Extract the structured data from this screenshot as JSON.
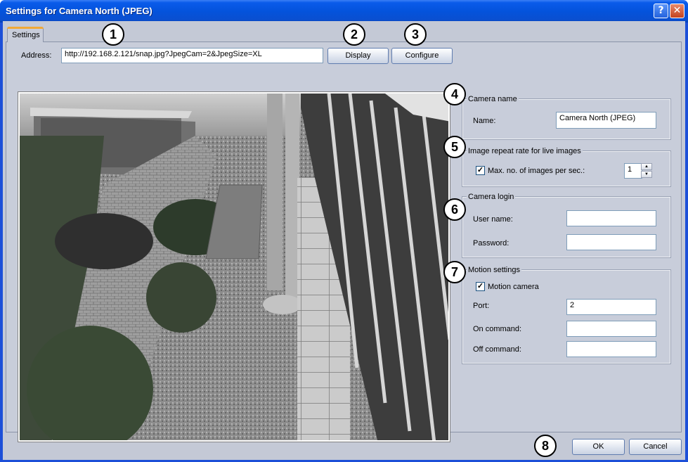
{
  "window": {
    "title": "Settings for Camera North (JPEG)",
    "help_glyph": "?",
    "close_glyph": "✕"
  },
  "tabs": [
    {
      "label": "Settings",
      "active": true
    }
  ],
  "address": {
    "label": "Address:",
    "value": "http://192.168.2.121/snap.jpg?JpegCam=2&JpegSize=XL"
  },
  "toolbar": {
    "display_label": "Display",
    "configure_label": "Configure"
  },
  "camera_name": {
    "group_title": "Camera name",
    "name_label": "Name:",
    "name_value": "Camera North (JPEG)"
  },
  "repeat_rate": {
    "group_title": "Image repeat rate for live images",
    "checkbox_label": "Max. no. of images per sec.:",
    "checked": true,
    "value": "1"
  },
  "login": {
    "group_title": "Camera login",
    "user_label": "User name:",
    "user_value": "",
    "password_label": "Password:",
    "password_value": ""
  },
  "motion": {
    "group_title": "Motion settings",
    "checkbox_label": "Motion camera",
    "checked": true,
    "port_label": "Port:",
    "port_value": "2",
    "on_label": "On command:",
    "on_value": "",
    "off_label": "Off command:",
    "off_value": ""
  },
  "footer": {
    "ok_label": "OK",
    "cancel_label": "Cancel"
  },
  "callouts": [
    "1",
    "2",
    "3",
    "4",
    "5",
    "6",
    "7",
    "8"
  ],
  "colors": {
    "titlebar": "#0453dc",
    "dialog_bg": "#c8cdda",
    "callout_border": "#000000"
  }
}
